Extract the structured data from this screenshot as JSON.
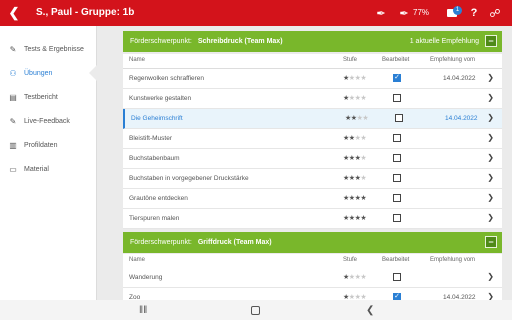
{
  "header": {
    "title": "S., Paul - Gruppe: 1b",
    "battery": "77%",
    "notification_count": "1",
    "back_icon": "chevron-left-icon"
  },
  "sidebar": {
    "items": [
      {
        "label": "Tests & Ergebnisse",
        "icon": "pencil-icon",
        "active": false
      },
      {
        "label": "Übungen",
        "icon": "figure-icon",
        "active": true
      },
      {
        "label": "Testbericht",
        "icon": "chart-icon",
        "active": false
      },
      {
        "label": "Live-Feedback",
        "icon": "live-feedback-icon",
        "active": false
      },
      {
        "label": "Profildaten",
        "icon": "profile-icon",
        "active": false
      },
      {
        "label": "Material",
        "icon": "document-icon",
        "active": false
      }
    ]
  },
  "columns": {
    "name": "Name",
    "level": "Stufe",
    "done": "Bearbeitet",
    "recommended": "Empfehlung vom"
  },
  "sections": [
    {
      "label": "Förderschwerpunkt:",
      "name": "Schreibdruck (Team Max)",
      "count": "1 aktuelle Empfehlung",
      "collapse": "−",
      "rows": [
        {
          "name": "Regenwolken schraffieren",
          "level": 1,
          "done": true,
          "date": "14.04.2022"
        },
        {
          "name": "Kunstwerke gestalten",
          "level": 1,
          "done": false,
          "date": ""
        },
        {
          "name": "Die Geheimschrift",
          "level": 2,
          "done": false,
          "date": "14.04.2022",
          "highlighted": true
        },
        {
          "name": "Bleistift-Muster",
          "level": 2,
          "done": false,
          "date": ""
        },
        {
          "name": "Buchstabenbaum",
          "level": 3,
          "done": false,
          "date": ""
        },
        {
          "name": "Buchstaben in vorgegebener Druckstärke",
          "level": 3,
          "done": false,
          "date": ""
        },
        {
          "name": "Grautöne entdecken",
          "level": 4,
          "done": false,
          "date": ""
        },
        {
          "name": "Tierspuren malen",
          "level": 4,
          "done": false,
          "date": ""
        }
      ]
    },
    {
      "label": "Förderschwerpunkt:",
      "name": "Griffdruck (Team Max)",
      "count": "",
      "collapse": "−",
      "rows": [
        {
          "name": "Wanderung",
          "level": 1,
          "done": false,
          "date": ""
        },
        {
          "name": "Zoo",
          "level": 1,
          "done": true,
          "date": "14.04.2022"
        }
      ]
    }
  ],
  "bottom_nav": {
    "recents_icon": "recents-icon",
    "home_icon": "home-icon",
    "back_icon": "back-icon"
  },
  "colors": {
    "brand_red": "#d3131b",
    "section_green": "#79b72b",
    "accent_blue": "#2a7fd4"
  }
}
